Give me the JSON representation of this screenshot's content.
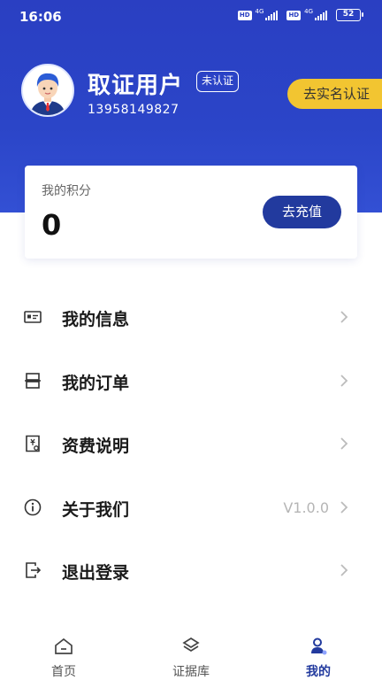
{
  "status_bar": {
    "time": "16:06",
    "network_1": "4G",
    "network_2": "4G",
    "hd_label": "HD",
    "battery": "52"
  },
  "profile": {
    "name": "取证用户",
    "auth_status": "未认证",
    "phone": "13958149827",
    "verify_button": "去实名认证"
  },
  "points": {
    "label": "我的积分",
    "value": "0",
    "recharge_button": "去充值"
  },
  "menu": {
    "items": [
      {
        "label": "我的信息",
        "value": "",
        "icon": "id-card-icon"
      },
      {
        "label": "我的订单",
        "value": "",
        "icon": "order-icon"
      },
      {
        "label": "资费说明",
        "value": "",
        "icon": "fee-document-icon"
      },
      {
        "label": "关于我们",
        "value": "V1.0.0",
        "icon": "info-circle-icon"
      },
      {
        "label": "退出登录",
        "value": "",
        "icon": "logout-icon"
      }
    ]
  },
  "tab_bar": {
    "tabs": [
      {
        "label": "首页",
        "icon": "home-icon",
        "active": false
      },
      {
        "label": "证据库",
        "icon": "layers-icon",
        "active": false
      },
      {
        "label": "我的",
        "icon": "user-icon",
        "active": true
      }
    ]
  },
  "colors": {
    "header_blue": "#2a3fc2",
    "accent_dark_blue": "#223a9e",
    "verify_yellow": "#f2c531"
  }
}
